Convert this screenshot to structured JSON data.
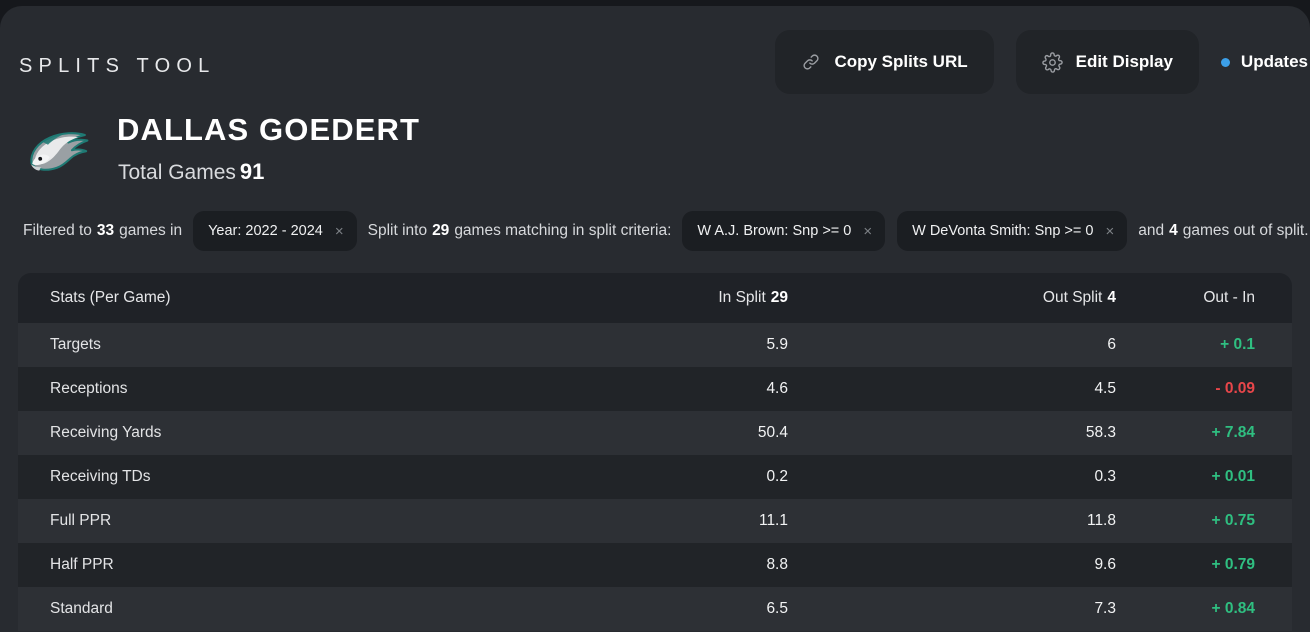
{
  "brand": "SPLITS TOOL",
  "topbar": {
    "copy_url_label": "Copy Splits URL",
    "copy_url_icon": "link-icon",
    "edit_display_label": "Edit Display",
    "edit_display_icon": "gear-icon",
    "updates_label": "Updates",
    "updates_dot_color": "#3c9fe8"
  },
  "player": {
    "name": "DALLAS GOEDERT",
    "team_logo": "philadelphia-eagles-logo",
    "total_games_label": "Total Games",
    "total_games_value": "91"
  },
  "filters": {
    "prefix": "Filtered to",
    "filtered_games": "33",
    "prefix_tail": "games in",
    "base_chips": [
      {
        "label": "Year: 2022 - 2024",
        "remove": "×"
      }
    ],
    "split_prefix": "Split into",
    "split_games": "29",
    "split_prefix_tail": "games matching in split criteria:",
    "split_chips": [
      {
        "label": "W A.J. Brown: Snp >= 0",
        "remove": "×"
      },
      {
        "label": "W DeVonta Smith: Snp >= 0",
        "remove": "×"
      }
    ],
    "suffix_lead": "and",
    "out_games": "4",
    "suffix_tail": "games out of split."
  },
  "table": {
    "headers": {
      "stat": "Stats (Per Game)",
      "in_split_label": "In Split",
      "in_split_count": "29",
      "out_split_label": "Out Split",
      "out_split_count": "4",
      "diff": "Out - In"
    },
    "rows": [
      {
        "stat": "Targets",
        "in": "5.9",
        "out": "6",
        "diff": "+ 0.1",
        "sign": "pos"
      },
      {
        "stat": "Receptions",
        "in": "4.6",
        "out": "4.5",
        "diff": "- 0.09",
        "sign": "neg"
      },
      {
        "stat": "Receiving Yards",
        "in": "50.4",
        "out": "58.3",
        "diff": "+ 7.84",
        "sign": "pos"
      },
      {
        "stat": "Receiving TDs",
        "in": "0.2",
        "out": "0.3",
        "diff": "+ 0.01",
        "sign": "pos"
      },
      {
        "stat": "Full PPR",
        "in": "11.1",
        "out": "11.8",
        "diff": "+ 0.75",
        "sign": "pos"
      },
      {
        "stat": "Half PPR",
        "in": "8.8",
        "out": "9.6",
        "diff": "+ 0.79",
        "sign": "pos"
      },
      {
        "stat": "Standard",
        "in": "6.5",
        "out": "7.3",
        "diff": "+ 0.84",
        "sign": "pos"
      }
    ]
  },
  "colors": {
    "positive": "#2fbf81",
    "negative": "#e8464a",
    "panel": "#282b30",
    "row_light": "#2d3035",
    "row_dark": "#212428",
    "header_row": "#1f2227",
    "accent_blue": "#3c9fe8"
  }
}
